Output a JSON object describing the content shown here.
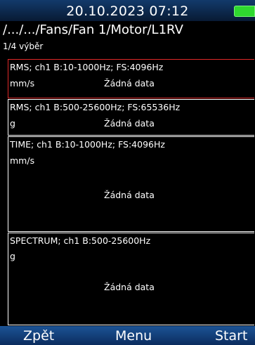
{
  "status": {
    "datetime": "20.10.2023 07:12",
    "battery_icon": "battery-full-icon",
    "battery_color": "#2fd82f"
  },
  "header": {
    "path": "/.../.../Fans/Fan 1/Motor/L1RV",
    "selection": "1/4 výběr"
  },
  "panels": [
    {
      "title": "RMS; ch1 B:10-1000Hz; FS:4096Hz",
      "unit": "mm/s",
      "status": "Žádná data"
    },
    {
      "title": "RMS; ch1 B:500-25600Hz; FS:65536Hz",
      "unit": "g",
      "status": "Žádná data"
    },
    {
      "title": "TIME; ch1 B:10-1000Hz; FS:4096Hz",
      "unit": "mm/s",
      "status": "Žádná data"
    },
    {
      "title": "SPECTRUM; ch1 B:500-25600Hz",
      "unit": "g",
      "status": "Žádná data"
    }
  ],
  "softkeys": {
    "left": "Zpět",
    "middle": "Menu",
    "right": "Start"
  },
  "colors": {
    "selected_border": "#e02828",
    "panel_border": "#ffffff",
    "bar_blue": "#1c5496"
  }
}
